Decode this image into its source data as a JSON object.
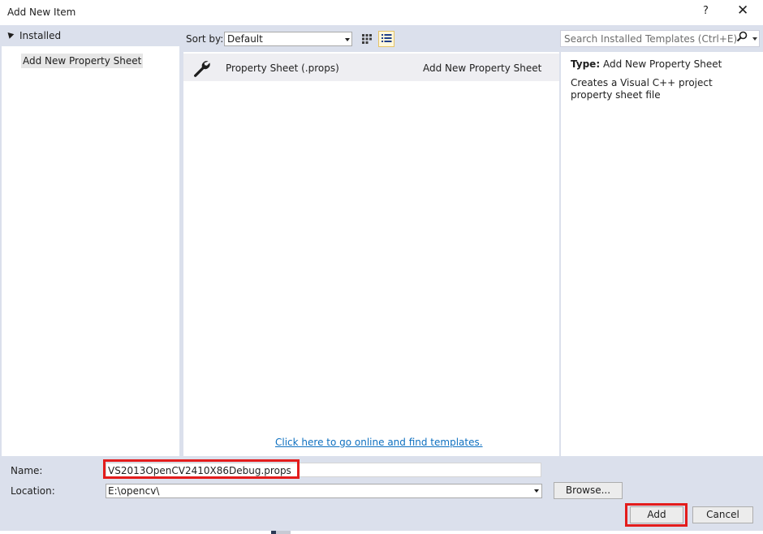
{
  "window": {
    "title": "Add New Item",
    "help_glyph": "?",
    "close_glyph": "✕"
  },
  "left_panel": {
    "header": "Installed",
    "items": [
      {
        "label": "Add New Property Sheet",
        "selected": true
      }
    ]
  },
  "toolbar": {
    "sort_label": "Sort by:",
    "sort_value": "Default",
    "search_placeholder": "Search Installed Templates (Ctrl+E)"
  },
  "templates": [
    {
      "icon": "wrench-icon",
      "name": "Property Sheet (.props)",
      "category": "Add New Property Sheet"
    }
  ],
  "online_link": "Click here to go online and find templates.",
  "details": {
    "type_label": "Type:",
    "type_value": "Add New Property Sheet",
    "description": "Creates a Visual C++ project property sheet file"
  },
  "form": {
    "name_label": "Name:",
    "name_value": "VS2013OpenCV2410X86Debug.props",
    "location_label": "Location:",
    "location_value": "E:\\opencv\\",
    "browse_label": "Browse...",
    "add_label": "Add",
    "cancel_label": "Cancel"
  },
  "colors": {
    "highlight": "#e31c1c",
    "link": "#0e70c0",
    "dialog_bg": "#dbe0ec"
  }
}
